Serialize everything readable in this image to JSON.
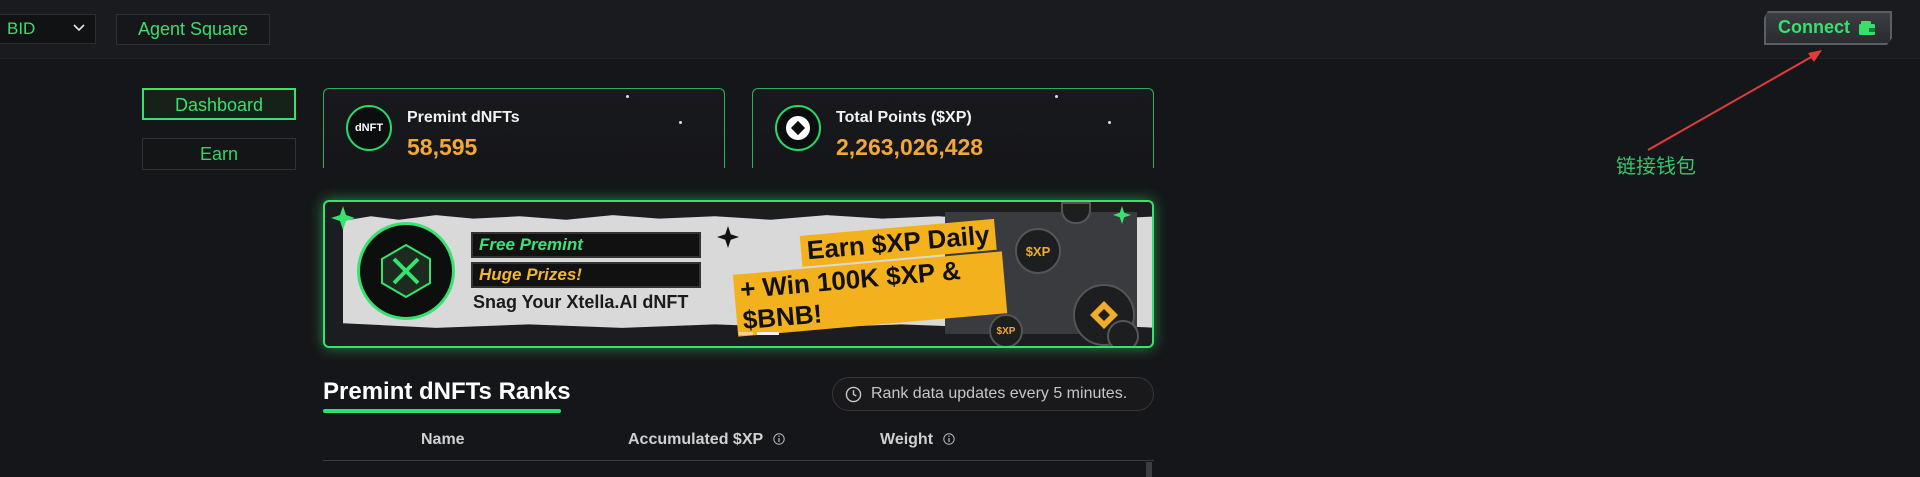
{
  "topbar": {
    "network_select": {
      "value": "BID"
    },
    "agent_square_label": "Agent Square",
    "connect_label": "Connect"
  },
  "annotation": {
    "label": "链接钱包",
    "color": "#e23b3b"
  },
  "sidebar": {
    "items": [
      {
        "label": "Dashboard",
        "active": true
      },
      {
        "label": "Earn",
        "active": false
      }
    ]
  },
  "stats": [
    {
      "icon_text": "dNFT",
      "title": "Premint dNFTs",
      "value": "58,595"
    },
    {
      "icon": "points-icon",
      "title": "Total Points ($XP)",
      "value": "2,263,026,428"
    }
  ],
  "banner": {
    "tag1": "Free Premint",
    "tag2": "Huge Prizes!",
    "subtitle": "Snag Your Xtella.AI dNFT",
    "headline1": "Earn $XP Daily",
    "headline2": "+ Win 100K $XP & $BNB!",
    "coin_label": "$XP",
    "accent": "#37e36e",
    "highlight": "#f4b11e"
  },
  "ranks": {
    "title": "Premint dNFTs Ranks",
    "update_note": "Rank data updates every 5 minutes.",
    "columns": [
      "Name",
      "Accumulated $XP",
      "Weight"
    ]
  },
  "colors": {
    "brand_green": "#38e06b",
    "value_orange": "#f2a838",
    "background": "#151619"
  }
}
